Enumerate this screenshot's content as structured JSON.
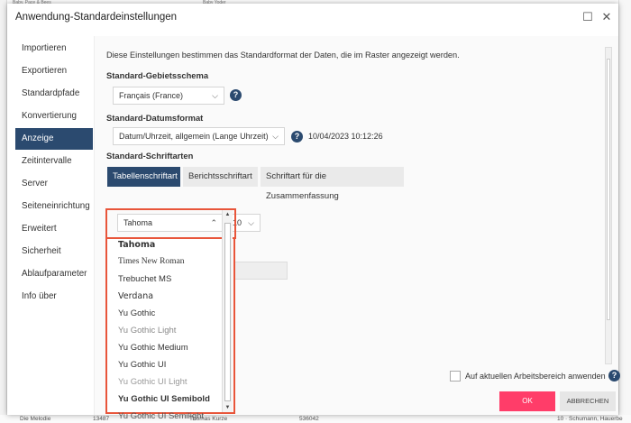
{
  "dialog": {
    "title": "Anwendung-Standardeinstellungen",
    "maximize_glyph": "☐",
    "close_glyph": "✕"
  },
  "sidebar": {
    "items": [
      {
        "label": "Importieren"
      },
      {
        "label": "Exportieren"
      },
      {
        "label": "Standardpfade"
      },
      {
        "label": "Konvertierung"
      },
      {
        "label": "Anzeige",
        "active": true
      },
      {
        "label": "Zeitintervalle"
      },
      {
        "label": "Server"
      },
      {
        "label": "Seiteneinrichtung"
      },
      {
        "label": "Erweitert"
      },
      {
        "label": "Sicherheit"
      },
      {
        "label": "Ablaufparameter"
      },
      {
        "label": "Info über"
      }
    ]
  },
  "content": {
    "description": "Diese Einstellungen bestimmen das Standardformat der Daten, die im Raster angezeigt werden.",
    "locale_section": "Standard-Gebietsschema",
    "locale_value": "Français (France)",
    "date_section": "Standard-Datumsformat",
    "date_format_value": "Datum/Uhrzeit, allgemein (Lange Uhrzeit)",
    "date_preview": "10/04/2023 10:12:26",
    "fonts_section": "Standard-Schriftarten",
    "tabs": [
      {
        "label": "Tabellenschriftart",
        "active": true
      },
      {
        "label": "Berichtsschriftart"
      },
      {
        "label": "Schriftart für die Zusammenfassung"
      }
    ],
    "font_value": "Tahoma",
    "font_size_value": "10",
    "apply_label": "Auf aktuellen Arbeitsbereich anwenden"
  },
  "font_list": {
    "items": [
      {
        "label": "Tahoma",
        "bold": true
      },
      {
        "label": "Times New Roman"
      },
      {
        "label": "Trebuchet MS"
      },
      {
        "label": "Verdana"
      },
      {
        "label": "Yu Gothic"
      },
      {
        "label": "Yu Gothic Light"
      },
      {
        "label": "Yu Gothic Medium"
      },
      {
        "label": "Yu Gothic UI"
      },
      {
        "label": "Yu Gothic UI Light"
      },
      {
        "label": "Yu Gothic UI Semibold",
        "bold": true
      },
      {
        "label": "Yu Gothic UI Semilight"
      }
    ]
  },
  "buttons": {
    "ok": "OK",
    "cancel": "ABBRECHEN"
  },
  "background": {
    "bottom_left": "Die Melodie",
    "bottom_num": "13487",
    "bottom_name": "Thomas Kurze",
    "bottom_code": "536042",
    "bottom_right": "10 · Schumann, Hauerbe",
    "top_left": "Baby, Pace & Bees",
    "top_name": "Baby Yoder"
  },
  "colors": {
    "accent": "#2b4a6f",
    "ok": "#ff3d69",
    "highlight": "#e8553a"
  }
}
